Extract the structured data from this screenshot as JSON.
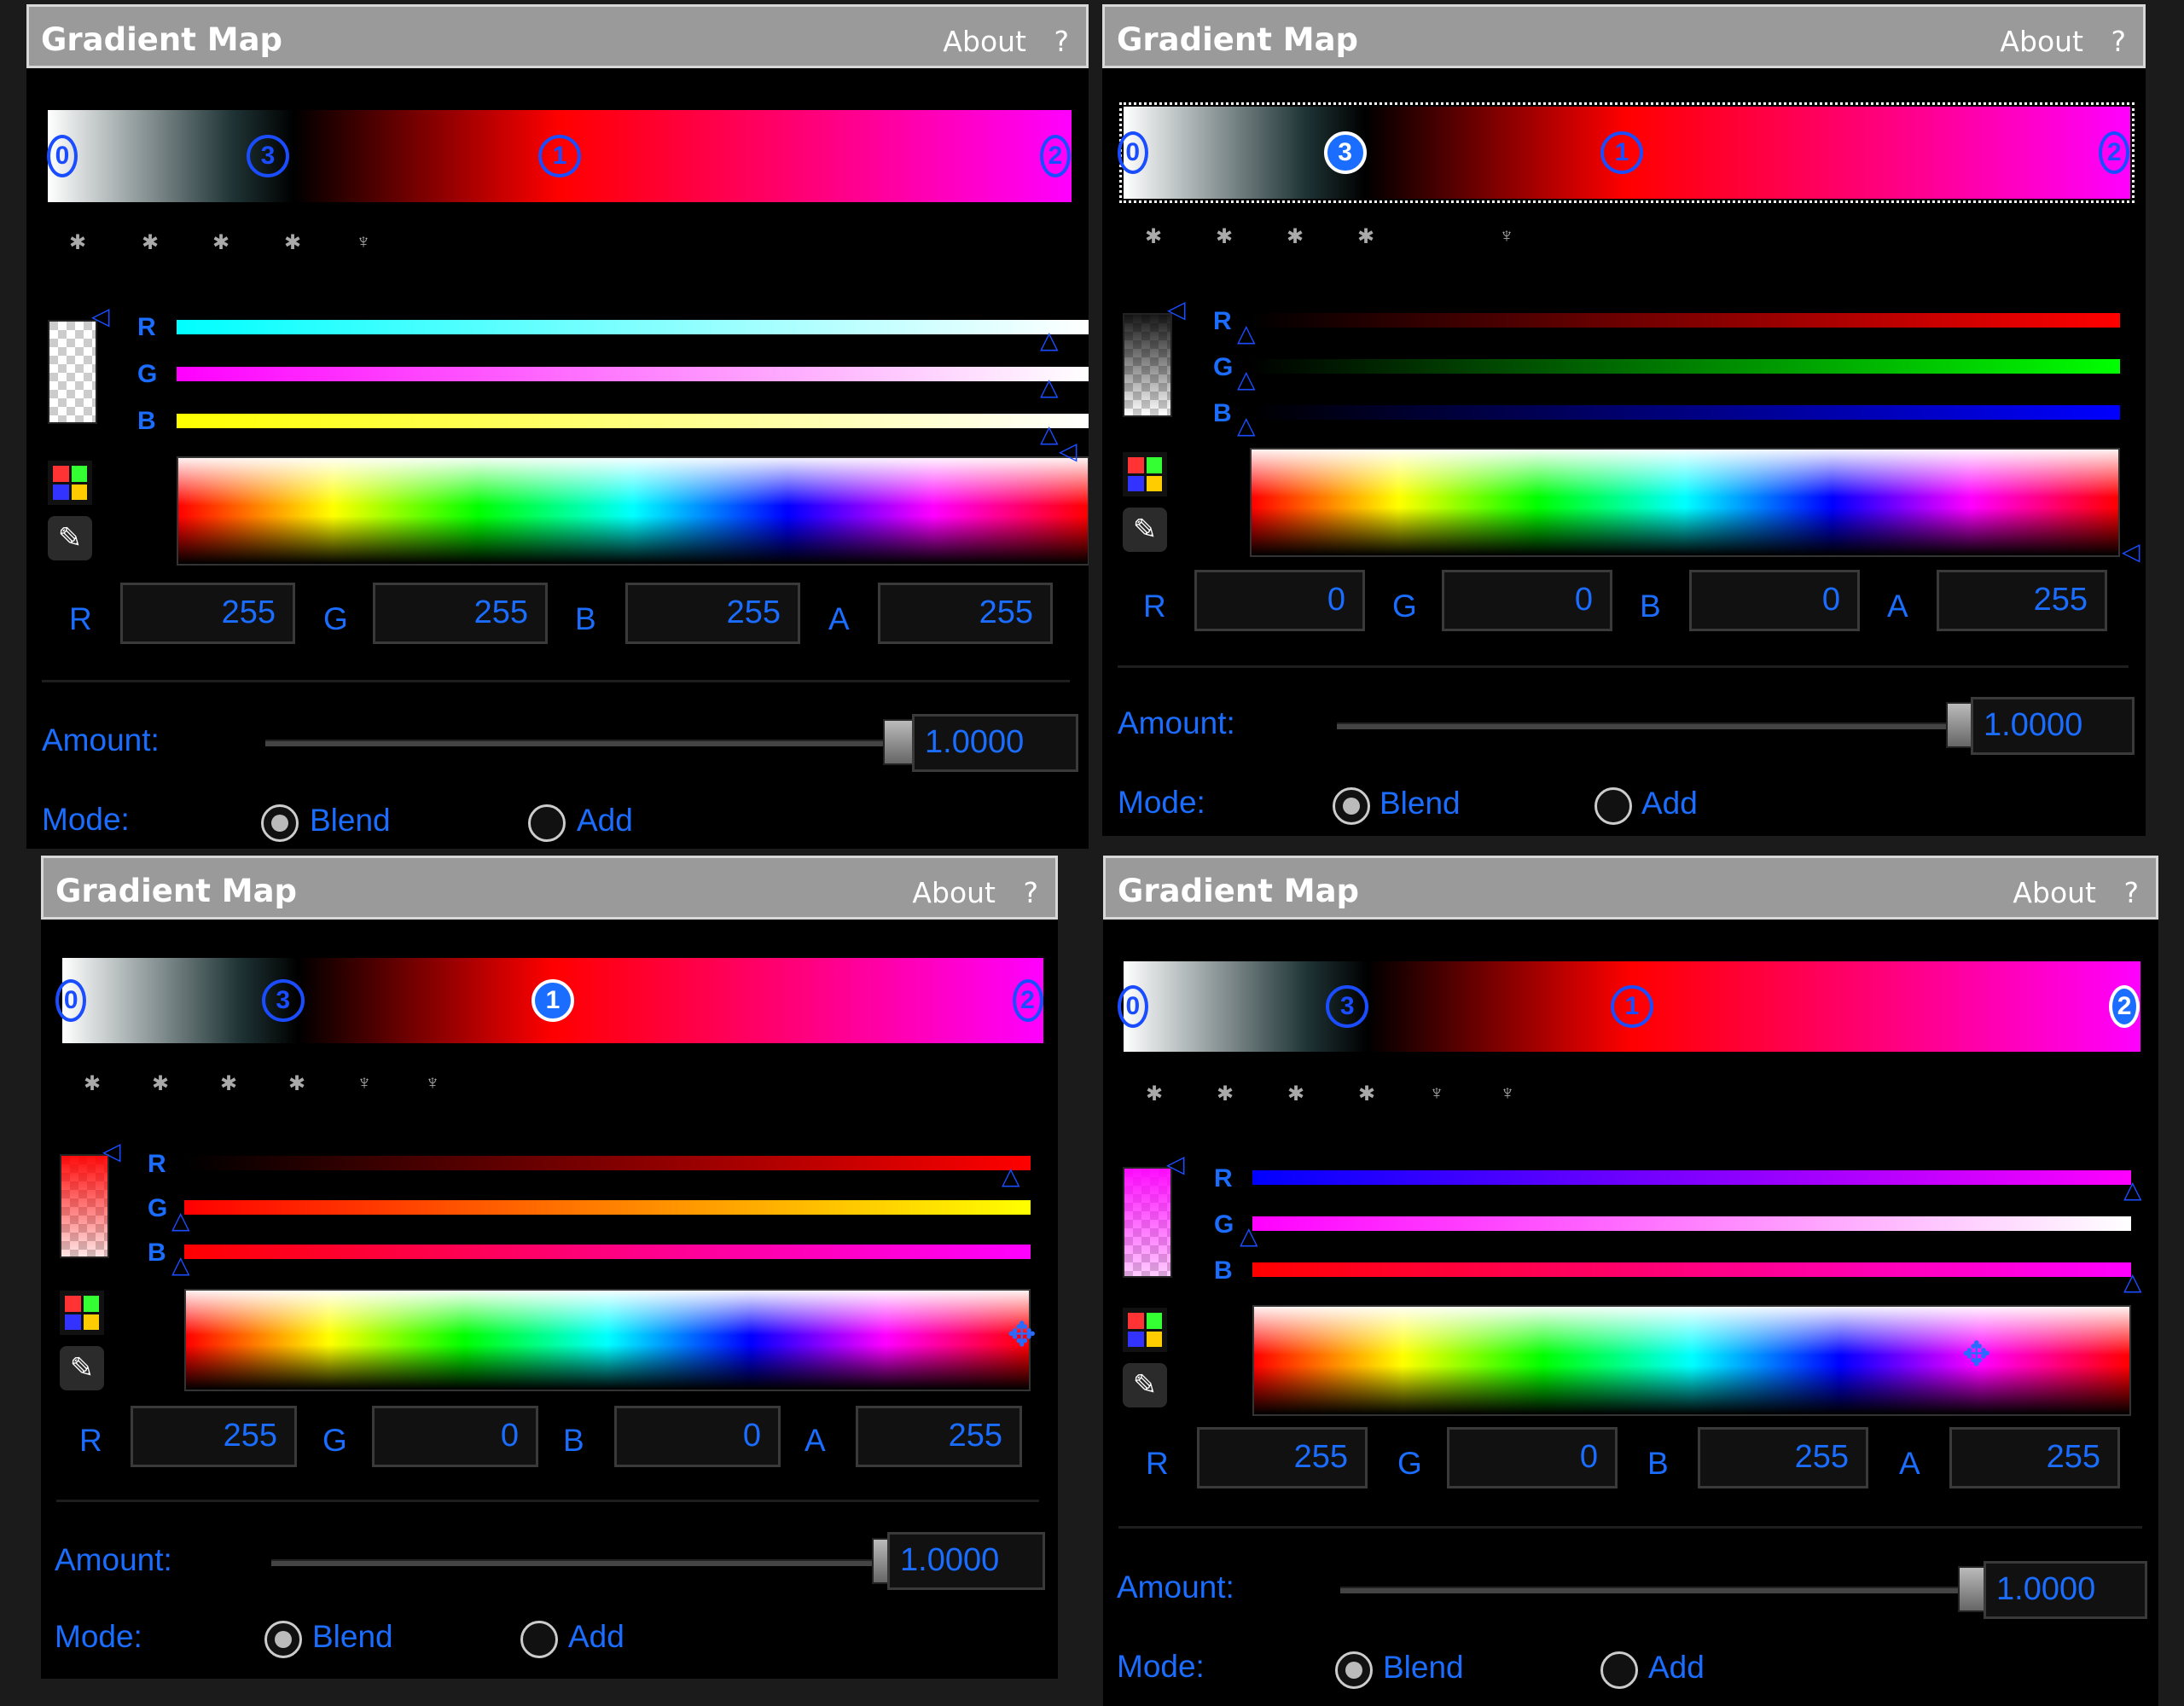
{
  "panels": [
    {
      "title": "Gradient Map",
      "about": "About",
      "help": "?",
      "stops": [
        {
          "label": "0",
          "pos": 0
        },
        {
          "label": "3",
          "pos": 22
        },
        {
          "label": "1",
          "pos": 50
        },
        {
          "label": "2",
          "pos": 100
        }
      ],
      "selected_stop": "0",
      "channels": {
        "r_label": "R",
        "g_label": "G",
        "b_label": "B"
      },
      "fields": {
        "r_label": "R",
        "r": "255",
        "g_label": "G",
        "g": "255",
        "b_label": "B",
        "b": "255",
        "a_label": "A",
        "a": "255"
      },
      "amount_label": "Amount:",
      "amount": "1.0000",
      "amount_fraction": 1.0,
      "mode_label": "Mode:",
      "mode_blend": "Blend",
      "mode_add": "Add",
      "mode_selected": "Blend"
    },
    {
      "title": "Gradient Map",
      "about": "About",
      "help": "?",
      "stops": [
        {
          "label": "0",
          "pos": 0
        },
        {
          "label": "3",
          "pos": 22
        },
        {
          "label": "1",
          "pos": 50
        },
        {
          "label": "2",
          "pos": 100
        }
      ],
      "selected_stop": "3",
      "channels": {
        "r_label": "R",
        "g_label": "G",
        "b_label": "B"
      },
      "fields": {
        "r_label": "R",
        "r": "0",
        "g_label": "G",
        "g": "0",
        "b_label": "B",
        "b": "0",
        "a_label": "A",
        "a": "255"
      },
      "amount_label": "Amount:",
      "amount": "1.0000",
      "amount_fraction": 1.0,
      "mode_label": "Mode:",
      "mode_blend": "Blend",
      "mode_add": "Add",
      "mode_selected": "Blend"
    },
    {
      "title": "Gradient Map",
      "about": "About",
      "help": "?",
      "stops": [
        {
          "label": "0",
          "pos": 0
        },
        {
          "label": "3",
          "pos": 22
        },
        {
          "label": "1",
          "pos": 50
        },
        {
          "label": "2",
          "pos": 100
        }
      ],
      "selected_stop": "1",
      "channels": {
        "r_label": "R",
        "g_label": "G",
        "b_label": "B"
      },
      "fields": {
        "r_label": "R",
        "r": "255",
        "g_label": "G",
        "g": "0",
        "b_label": "B",
        "b": "0",
        "a_label": "A",
        "a": "255"
      },
      "amount_label": "Amount:",
      "amount": "1.0000",
      "amount_fraction": 1.0,
      "mode_label": "Mode:",
      "mode_blend": "Blend",
      "mode_add": "Add",
      "mode_selected": "Blend"
    },
    {
      "title": "Gradient Map",
      "about": "About",
      "help": "?",
      "stops": [
        {
          "label": "0",
          "pos": 0
        },
        {
          "label": "3",
          "pos": 22
        },
        {
          "label": "1",
          "pos": 50
        },
        {
          "label": "2",
          "pos": 100
        }
      ],
      "selected_stop": "2",
      "channels": {
        "r_label": "R",
        "g_label": "G",
        "b_label": "B"
      },
      "fields": {
        "r_label": "R",
        "r": "255",
        "g_label": "G",
        "g": "0",
        "b_label": "B",
        "b": "255",
        "a_label": "A",
        "a": "255"
      },
      "amount_label": "Amount:",
      "amount": "1.0000",
      "amount_fraction": 1.0,
      "mode_label": "Mode:",
      "mode_blend": "Blend",
      "mode_add": "Add",
      "mode_selected": "Blend"
    }
  ],
  "colors": {
    "accent": "#1a6dff",
    "title_bg": "#9a9a9a",
    "panel_bg": "#000000"
  }
}
